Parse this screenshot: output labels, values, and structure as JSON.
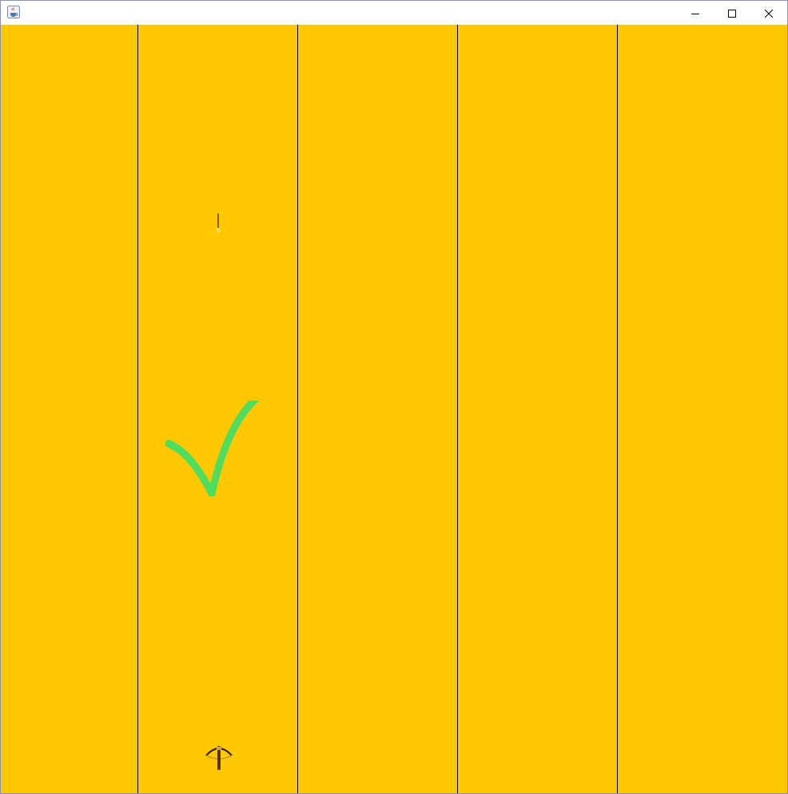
{
  "window": {
    "icon": "java-coffee-cup-icon",
    "controls": [
      "minimize-icon",
      "maximize-icon",
      "close-icon"
    ]
  },
  "game": {
    "lane_count": 5,
    "player_lane": 2,
    "background_color": "#ffc800",
    "divider_color": "#000000",
    "check_color": "#4fdc5f",
    "projectile": "arrow-icon",
    "player": "crossbow-icon",
    "feedback": "checkmark-icon"
  }
}
